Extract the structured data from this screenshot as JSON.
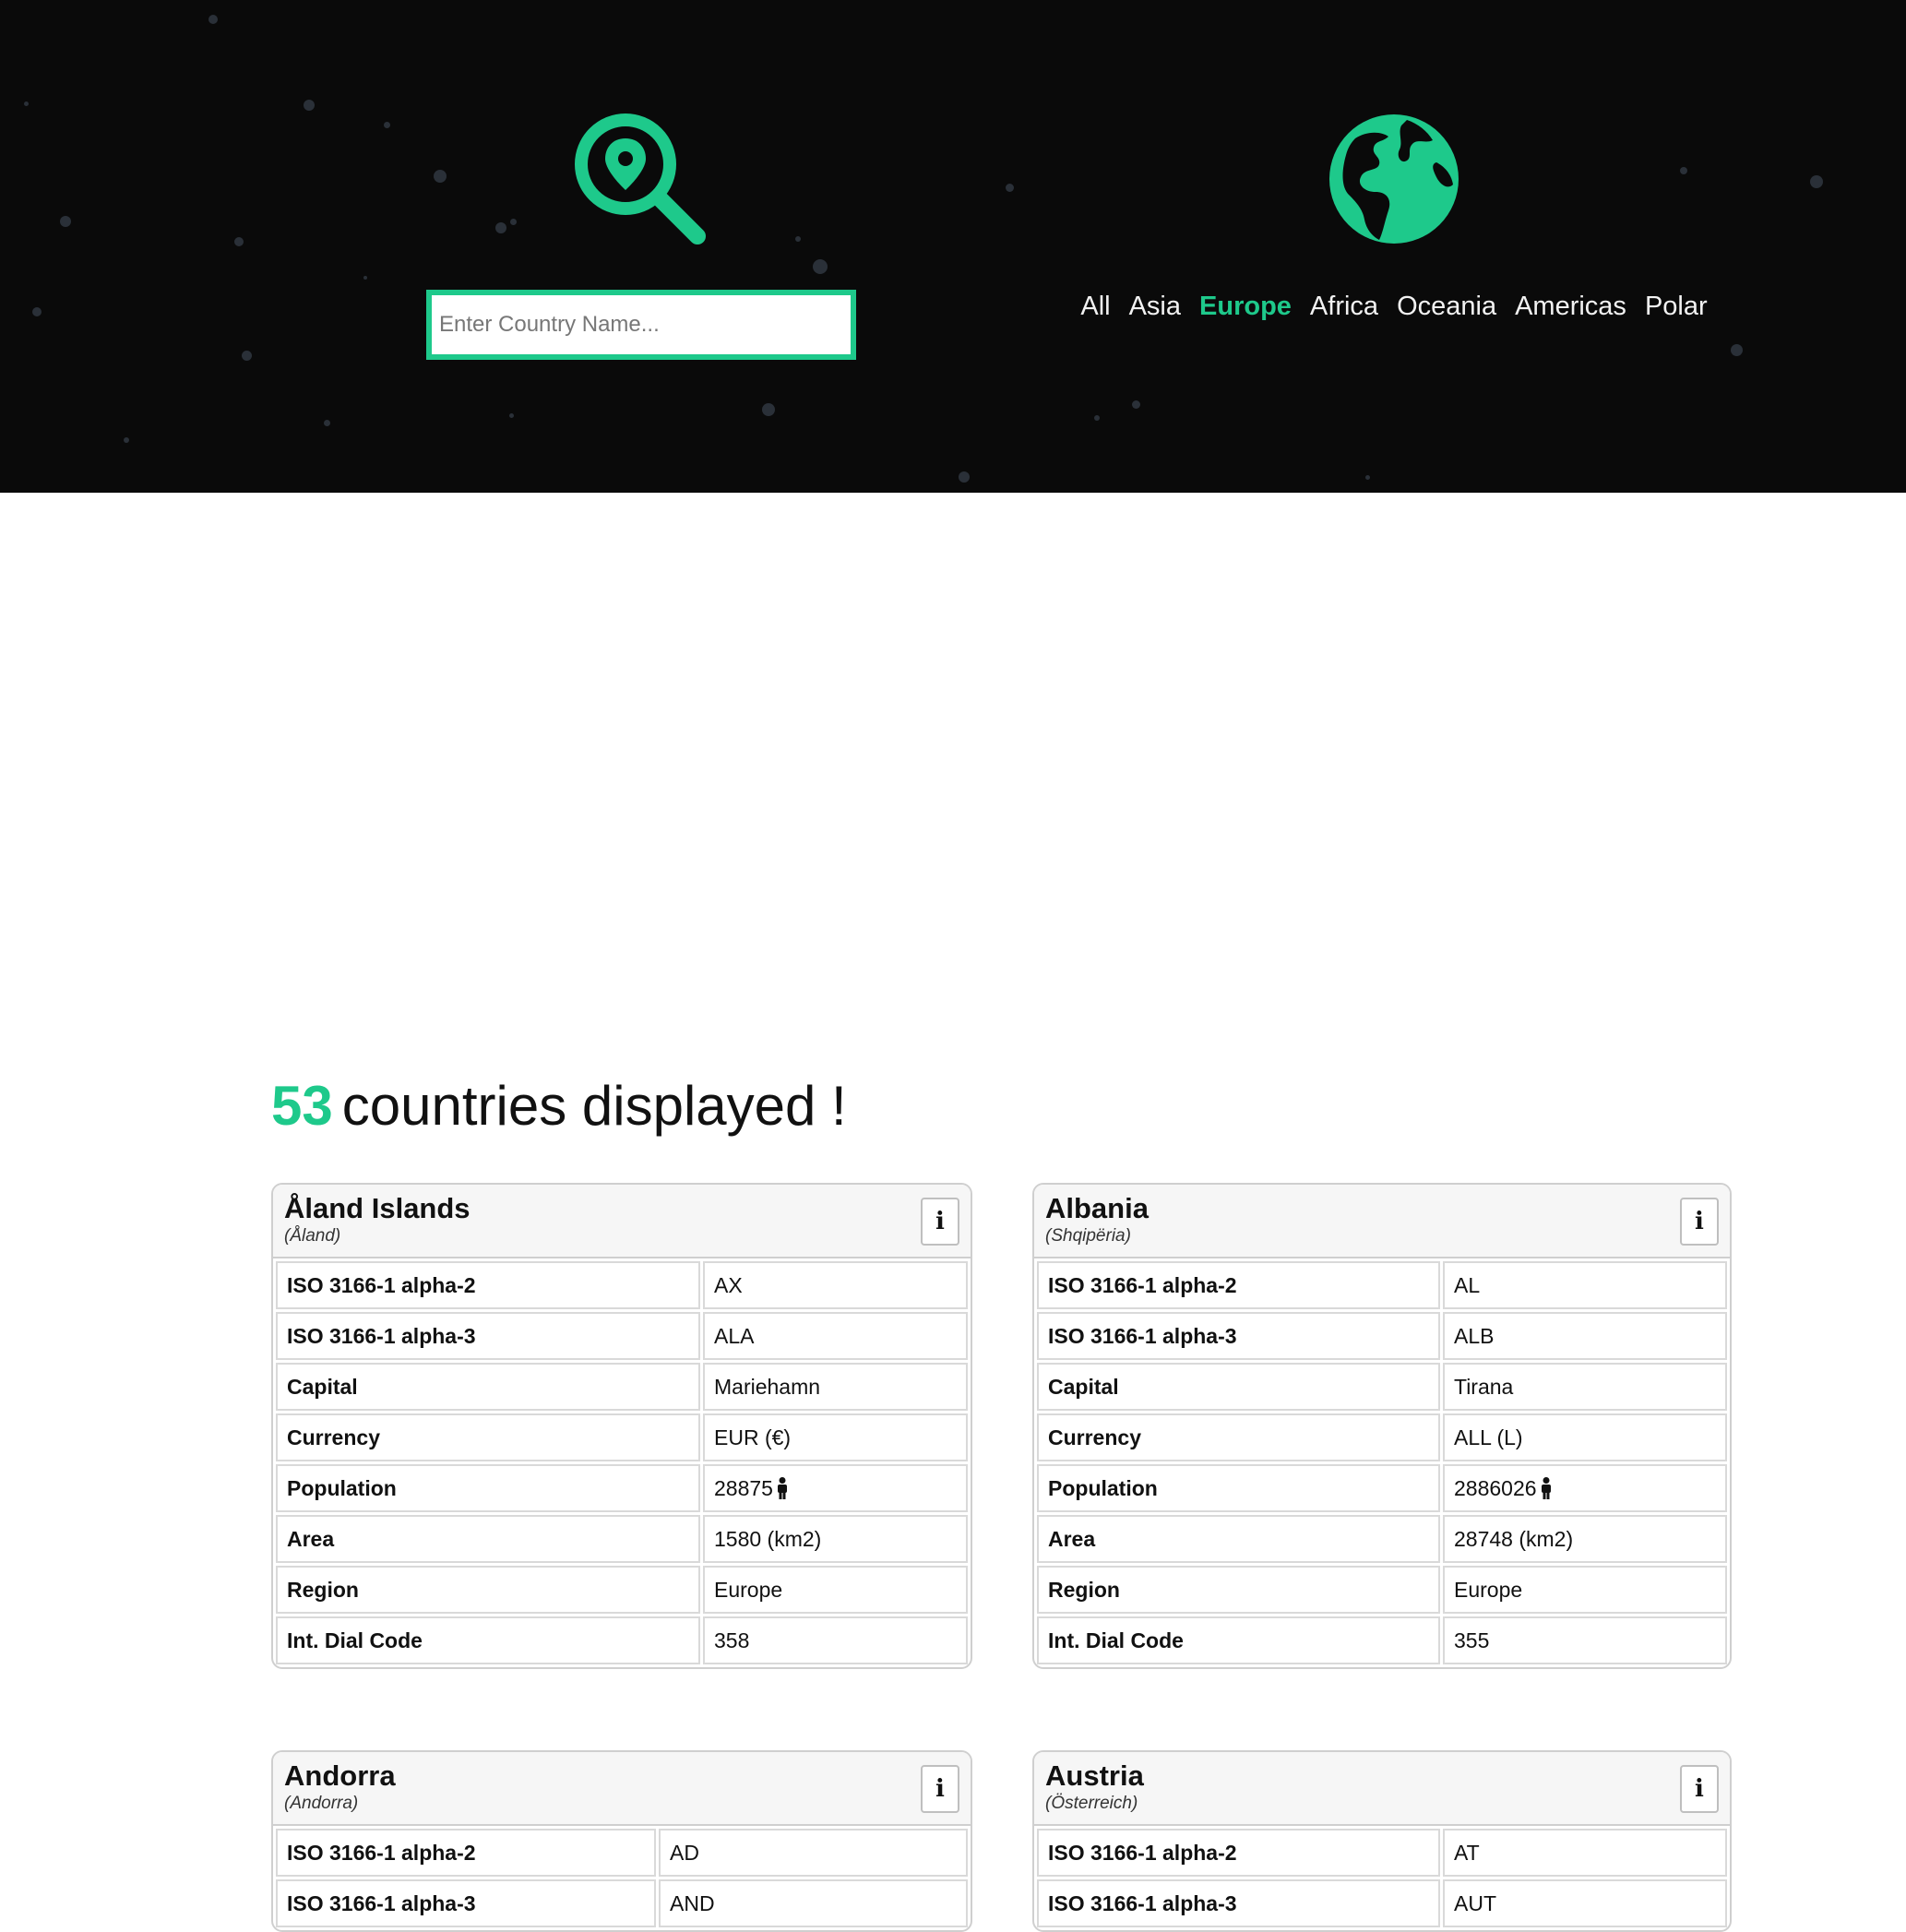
{
  "search": {
    "placeholder": "Enter Country Name...",
    "icon": "map-pin-search-icon",
    "accent": "#1ec98b"
  },
  "regions": {
    "icon": "globe-icon",
    "items": [
      "All",
      "Asia",
      "Europe",
      "Africa",
      "Oceania",
      "Americas",
      "Polar"
    ],
    "active": "Europe"
  },
  "summary": {
    "count": "53",
    "text": "countries displayed !"
  },
  "field_labels": {
    "alpha2": "ISO 3166-1 alpha-2",
    "alpha3": "ISO 3166-1 alpha-3",
    "capital": "Capital",
    "currency": "Currency",
    "population": "Population",
    "area": "Area",
    "region": "Region",
    "dial": "Int. Dial Code"
  },
  "info_button_label": "i",
  "countries": [
    {
      "name": "Åland Islands",
      "native": "(Åland)",
      "alpha2": "AX",
      "alpha3": "ALA",
      "capital": "Mariehamn",
      "currency": "EUR (€)",
      "population": "28875",
      "area": "1580 (km2)",
      "region": "Europe",
      "dial": "358"
    },
    {
      "name": "Albania",
      "native": "(Shqipëria)",
      "alpha2": "AL",
      "alpha3": "ALB",
      "capital": "Tirana",
      "currency": "ALL (L)",
      "population": "2886026",
      "area": "28748 (km2)",
      "region": "Europe",
      "dial": "355"
    },
    {
      "name": "Andorra",
      "native": "(Andorra)",
      "alpha2": "AD",
      "alpha3": "AND"
    },
    {
      "name": "Austria",
      "native": "(Österreich)",
      "alpha2": "AT",
      "alpha3": "AUT"
    }
  ]
}
